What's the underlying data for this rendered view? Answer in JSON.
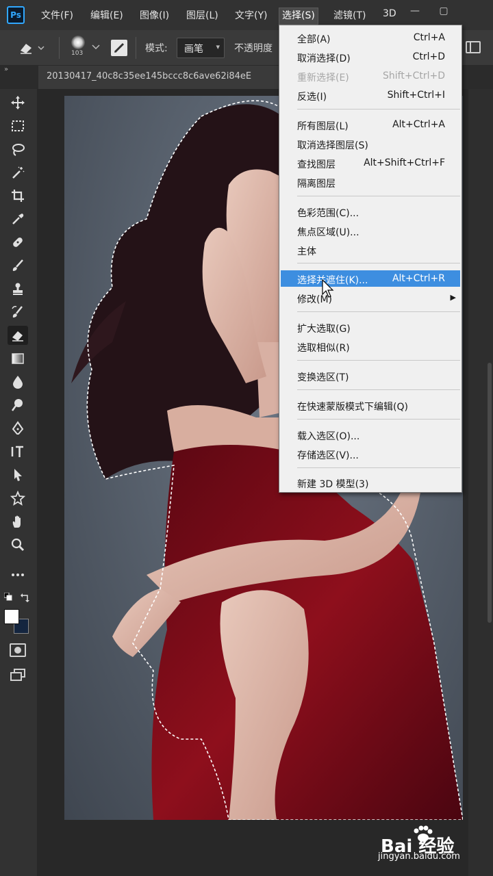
{
  "app": {
    "logo": "Ps"
  },
  "menubar": {
    "items": [
      "文件(F)",
      "编辑(E)",
      "图像(I)",
      "图层(L)",
      "文字(Y)",
      "选择(S)",
      "滤镜(T)",
      "3D"
    ],
    "active": "选择(S)"
  },
  "window_controls": {
    "minimize": "—",
    "maximize": "▢"
  },
  "options": {
    "brush_size": "103",
    "mode_label": "模式:",
    "mode_value": "画笔",
    "opacity_label": "不透明度"
  },
  "document": {
    "tab_title": "20130417_40c8c35ee145bccc8c6ave62i84eE"
  },
  "select_menu": {
    "items": [
      {
        "label": "全部(A)",
        "shortcut": "Ctrl+A",
        "disabled": false
      },
      {
        "label": "取消选择(D)",
        "shortcut": "Ctrl+D",
        "disabled": false
      },
      {
        "label": "重新选择(E)",
        "shortcut": "Shift+Ctrl+D",
        "disabled": true
      },
      {
        "label": "反选(I)",
        "shortcut": "Shift+Ctrl+I",
        "disabled": false
      },
      {
        "label": "所有图层(L)",
        "shortcut": "Alt+Ctrl+A",
        "disabled": false
      },
      {
        "label": "取消选择图层(S)",
        "shortcut": "",
        "disabled": false
      },
      {
        "label": "查找图层",
        "shortcut": "Alt+Shift+Ctrl+F",
        "disabled": false
      },
      {
        "label": "隔离图层",
        "shortcut": "",
        "disabled": false
      },
      {
        "label": "色彩范围(C)...",
        "shortcut": "",
        "disabled": false
      },
      {
        "label": "焦点区域(U)...",
        "shortcut": "",
        "disabled": false
      },
      {
        "label": "主体",
        "shortcut": "",
        "disabled": false
      },
      {
        "label": "选择并遮住(K)...",
        "shortcut": "Alt+Ctrl+R",
        "disabled": false,
        "highlighted": true
      },
      {
        "label": "修改(M)",
        "shortcut": "",
        "disabled": false,
        "submenu": true
      },
      {
        "label": "扩大选取(G)",
        "shortcut": "",
        "disabled": false
      },
      {
        "label": "选取相似(R)",
        "shortcut": "",
        "disabled": false
      },
      {
        "label": "变换选区(T)",
        "shortcut": "",
        "disabled": false
      },
      {
        "label": "在快速蒙版模式下编辑(Q)",
        "shortcut": "",
        "disabled": false
      },
      {
        "label": "载入选区(O)...",
        "shortcut": "",
        "disabled": false
      },
      {
        "label": "存储选区(V)...",
        "shortcut": "",
        "disabled": false
      },
      {
        "label": "新建 3D 模型(3)",
        "shortcut": "",
        "disabled": false
      }
    ]
  },
  "tools": [
    "move-tool",
    "marquee-tool",
    "lasso-tool",
    "magic-wand-tool",
    "crop-tool",
    "eyedropper-tool",
    "healing-brush-tool",
    "brush-tool",
    "clone-stamp-tool",
    "history-brush-tool",
    "eraser-tool",
    "gradient-tool",
    "blur-tool",
    "dodge-tool",
    "pen-tool",
    "type-tool",
    "path-selection-tool",
    "shape-tool",
    "hand-tool",
    "zoom-tool",
    "more-tools"
  ],
  "colors": {
    "foreground": "#ffffff",
    "background": "#14253f",
    "highlight": "#3d8ee0",
    "menu_bg": "#f0f0f0"
  },
  "watermark": {
    "text": "Bai 经验",
    "url": "jingyan.baidu.com"
  }
}
